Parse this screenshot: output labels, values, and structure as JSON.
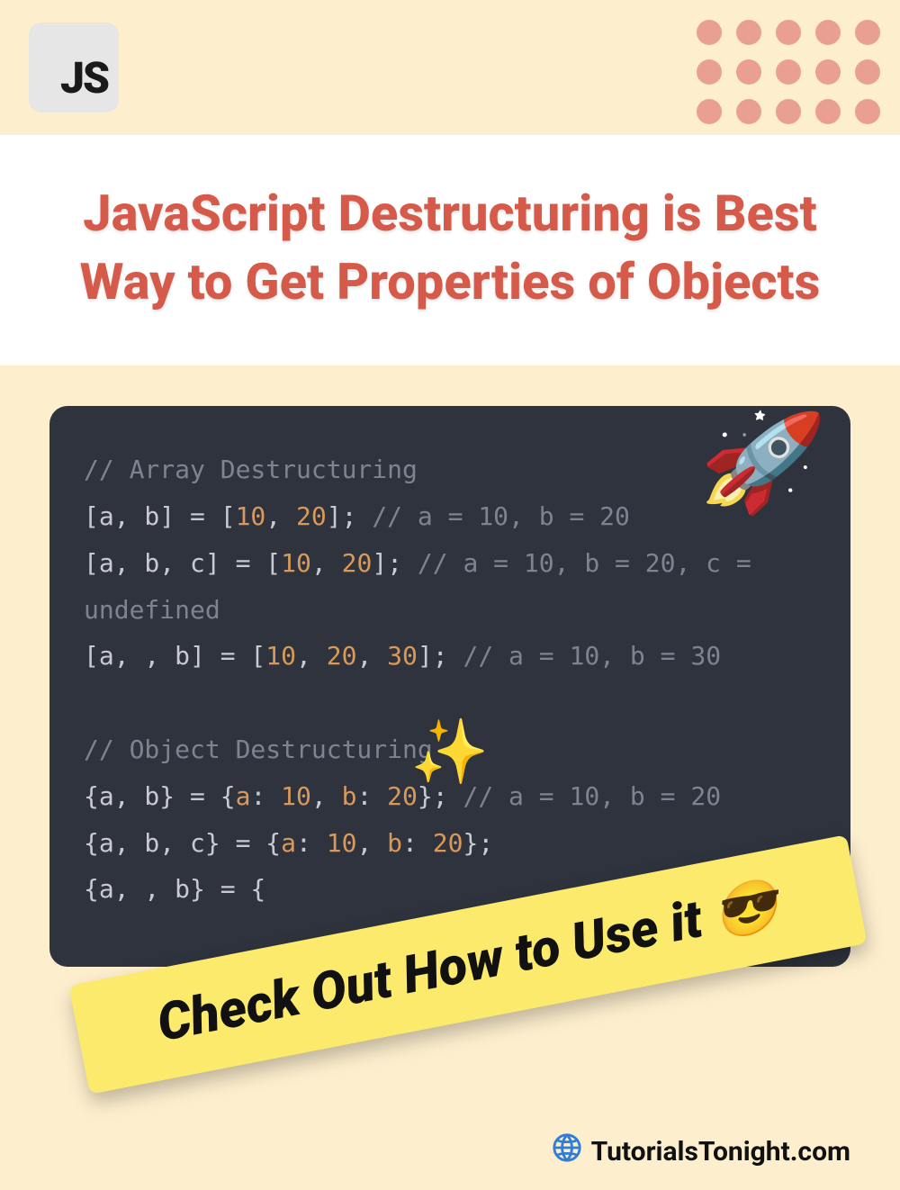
{
  "badge_text": "JS",
  "title": "JavaScript Destructuring is Best Way to Get Properties of Objects",
  "code": {
    "array_comment": "// Array Destructuring",
    "lines_array": [
      {
        "lhs": "[a, b]",
        "nums": [
          "10",
          "20"
        ],
        "trail": "; ",
        "comment": "// a = 10, b = 20"
      },
      {
        "lhs": "[a, b, c]",
        "nums": [
          "10",
          "20"
        ],
        "trail": "; ",
        "comment": "// a = 10, b = 20, c = undefined"
      },
      {
        "lhs": "[a, , b]",
        "nums": [
          "10",
          "20",
          "30"
        ],
        "trail": "; ",
        "comment": "// a = 10, b = 30"
      }
    ],
    "object_comment": "// Object Destructuring",
    "lines_object": [
      {
        "lhs": "{a, b}",
        "pairs": [
          {
            "k": "a",
            "v": "10"
          },
          {
            "k": "b",
            "v": "20"
          }
        ],
        "trail": "; ",
        "comment": "// a = 10, b = 20"
      },
      {
        "lhs": "{a, b, c}",
        "pairs": [
          {
            "k": "a",
            "v": "10"
          },
          {
            "k": "b",
            "v": "20"
          }
        ],
        "trail": "; ",
        "comment": ""
      },
      {
        "lhs": "{a, , b}",
        "pairs": [],
        "trail": "",
        "comment": ""
      }
    ]
  },
  "rocket": "🚀",
  "sparkles": "✨",
  "sticky_text": "Check Out How to Use it 😎",
  "footer_site": "TutorialsTonight.com",
  "dot_count": 15
}
